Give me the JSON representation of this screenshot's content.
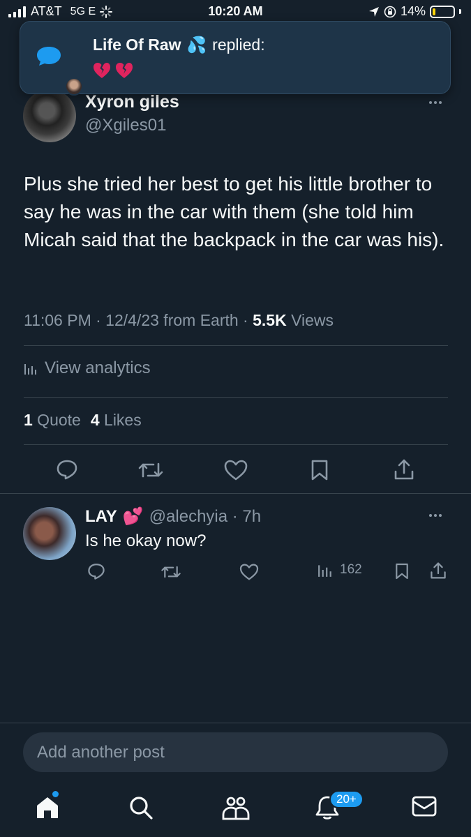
{
  "status_bar": {
    "carrier": "AT&T",
    "network": "5G E",
    "time": "10:20 AM",
    "battery": "14%",
    "battery_level": 0.14,
    "battery_color": "#ffd60a"
  },
  "notification": {
    "sender": "Life Of Raw",
    "sender_emoji": "💦",
    "action": "replied:",
    "body": "💔 💔"
  },
  "tweet": {
    "author_name": "Xyron giles",
    "author_handle": "@Xgiles01",
    "text": "Plus she tried her best to get his little brother to say he was in the car with them (she told him Micah said that the backpack in the car was his).",
    "timestamp": "11:06 PM · 12/4/23 from Earth · ",
    "views_count": "5.5K",
    "views_label": " Views",
    "analytics_label": "View analytics",
    "quote_count": "1",
    "quote_label": " Quote",
    "likes_count": "4",
    "likes_label": " Likes"
  },
  "reply": {
    "author_name": "LAY",
    "author_emoji": "💕",
    "handle_time": "@alechyia · 7h",
    "text": "Is he okay now?",
    "views": "162"
  },
  "compose": {
    "placeholder": "Add another post"
  },
  "tab_bar": {
    "notifications_badge": "20+"
  },
  "colors": {
    "background": "#15202b",
    "accent": "#1d9bf0",
    "muted_text": "#8b98a5",
    "divider": "#38444d",
    "broken_heart": "#e0245e"
  }
}
